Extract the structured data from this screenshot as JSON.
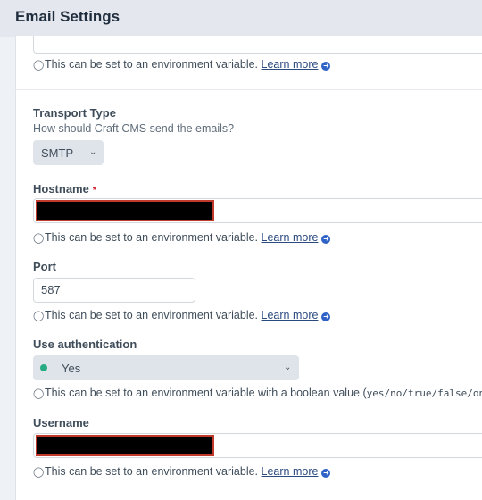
{
  "header": {
    "title": "Email Settings"
  },
  "hints": {
    "env_var": "This can be set to an environment variable.",
    "env_var_bool": "This can be set to an environment variable with a boolean value (",
    "bool_values": "yes/no/true/false/on/o",
    "learn_more": "Learn more"
  },
  "transport": {
    "label": "Transport Type",
    "instructions": "How should Craft CMS send the emails?",
    "selected": "SMTP"
  },
  "hostname": {
    "label": "Hostname",
    "required_mark": "*"
  },
  "port": {
    "label": "Port",
    "value": "587"
  },
  "auth": {
    "label": "Use authentication",
    "selected": "Yes",
    "status_color": "#27ab83"
  },
  "username": {
    "label": "Username"
  },
  "colors": {
    "link": "#2b4a80",
    "required": "#cf1124",
    "redaction_border": "#c0392b"
  },
  "icons": {
    "hint": "lightbulb-icon",
    "external_link": "external-link-icon",
    "dropdown": "chevron-down-icon"
  }
}
